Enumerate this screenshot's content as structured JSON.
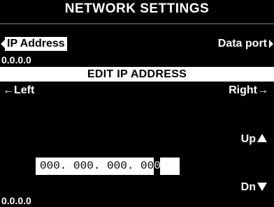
{
  "header": {
    "title": "NETWORK SETTINGS"
  },
  "tabs": {
    "left_tab": "IP Address",
    "right_tab": "Data port"
  },
  "current_ip_top": "0.0.0.0",
  "edit_bar": {
    "label": "EDIT IP ADDRESS"
  },
  "nav": {
    "left": "←Left",
    "right": "Right→",
    "up": "Up",
    "down": "Dn"
  },
  "ip_field": {
    "value_prefix": "000. 000. 000. 00",
    "cursor_char": "0"
  },
  "current_ip_bottom": "0.0.0.0",
  "colors": {
    "background": "#000000",
    "foreground": "#ffffff",
    "highlight_bg": "#ffffff",
    "highlight_fg": "#000000"
  },
  "icons": {
    "tab_left": "triangle-left-icon",
    "tab_right": "triangle-right-icon",
    "up": "triangle-up-icon",
    "down": "triangle-down-icon"
  }
}
